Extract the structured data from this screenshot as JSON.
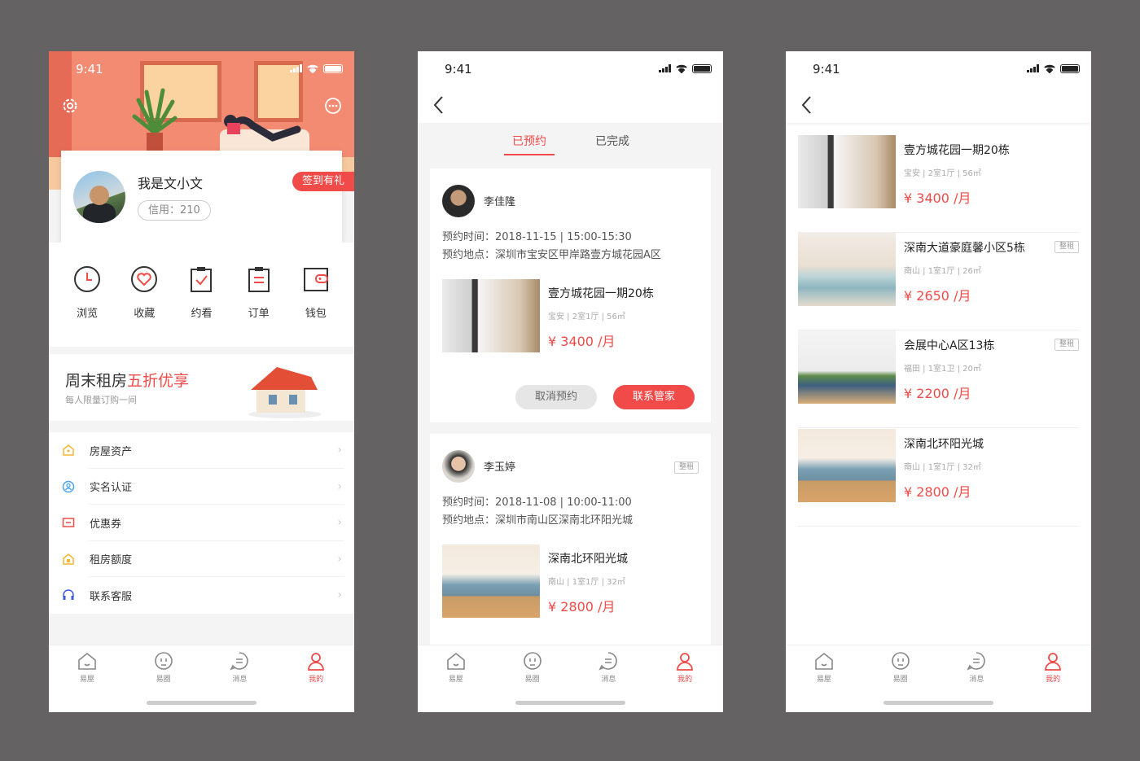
{
  "status": {
    "time": "9:41"
  },
  "tabs": [
    {
      "label": "易屋",
      "icon": "house-icon"
    },
    {
      "label": "易圈",
      "icon": "circle-face-icon"
    },
    {
      "label": "消息",
      "icon": "message-icon"
    },
    {
      "label": "我的",
      "icon": "profile-icon"
    }
  ],
  "screen1": {
    "username": "我是文小文",
    "credit": "信用：210",
    "signin": "签到有礼",
    "quick": [
      {
        "label": "浏览",
        "icon": "clock-icon"
      },
      {
        "label": "收藏",
        "icon": "heart-icon"
      },
      {
        "label": "约看",
        "icon": "clipboard-check-icon"
      },
      {
        "label": "订单",
        "icon": "order-icon"
      },
      {
        "label": "钱包",
        "icon": "wallet-icon"
      }
    ],
    "promo": {
      "title_a": "周末租房",
      "title_b": "五折优享",
      "sub": "每人限量订购一间"
    },
    "menu": [
      {
        "label": "房屋资产",
        "icon": "home-asset-icon",
        "color": "#f7b733"
      },
      {
        "label": "实名认证",
        "icon": "id-verify-icon",
        "color": "#4aa3f0"
      },
      {
        "label": "优惠券",
        "icon": "coupon-icon",
        "color": "#f04b48"
      },
      {
        "label": "租房额度",
        "icon": "quota-icon",
        "color": "#f7b733"
      },
      {
        "label": "联系客服",
        "icon": "headset-icon",
        "color": "#3b5bdb"
      }
    ]
  },
  "screen2": {
    "tabs": [
      "已预约",
      "已完成"
    ],
    "bookings": [
      {
        "name": "李佳隆",
        "time": "预约时间：2018-11-15 | 15:00-15:30",
        "place": "预约地点：深圳市宝安区甲岸路壹方城花园A区",
        "title": "壹方城花园一期20栋",
        "meta": "宝安 | 2室1厅 | 56㎡",
        "price": "¥ 3400 /月",
        "cancel": "取消预约",
        "contact": "联系管家"
      },
      {
        "name": "李玉婷",
        "tag": "整租",
        "time": "预约时间：2018-11-08 | 10:00-11:00",
        "place": "预约地点：深圳市南山区深南北环阳光城",
        "title": "深南北环阳光城",
        "meta": "南山 | 1室1厅 | 32㎡",
        "price": "¥ 2800 /月"
      }
    ]
  },
  "screen3": {
    "listings": [
      {
        "title": "壹方城花园一期20栋",
        "meta": "宝安 | 2室1厅 | 56㎡",
        "price": "¥ 3400 /月",
        "tag": ""
      },
      {
        "title": "深南大道豪庭馨小区5栋",
        "meta": "南山 | 1室1厅 | 26㎡",
        "price": "¥ 2650 /月",
        "tag": "整租"
      },
      {
        "title": "会展中心A区13栋",
        "meta": "福田 | 1室1卫 | 20㎡",
        "price": "¥ 2200 /月",
        "tag": "整租"
      },
      {
        "title": "深南北环阳光城",
        "meta": "南山 | 1室1厅 | 32㎡",
        "price": "¥ 2800 /月",
        "tag": ""
      }
    ]
  },
  "colors": {
    "accent": "#f04b48",
    "hero": "#f38b73"
  }
}
